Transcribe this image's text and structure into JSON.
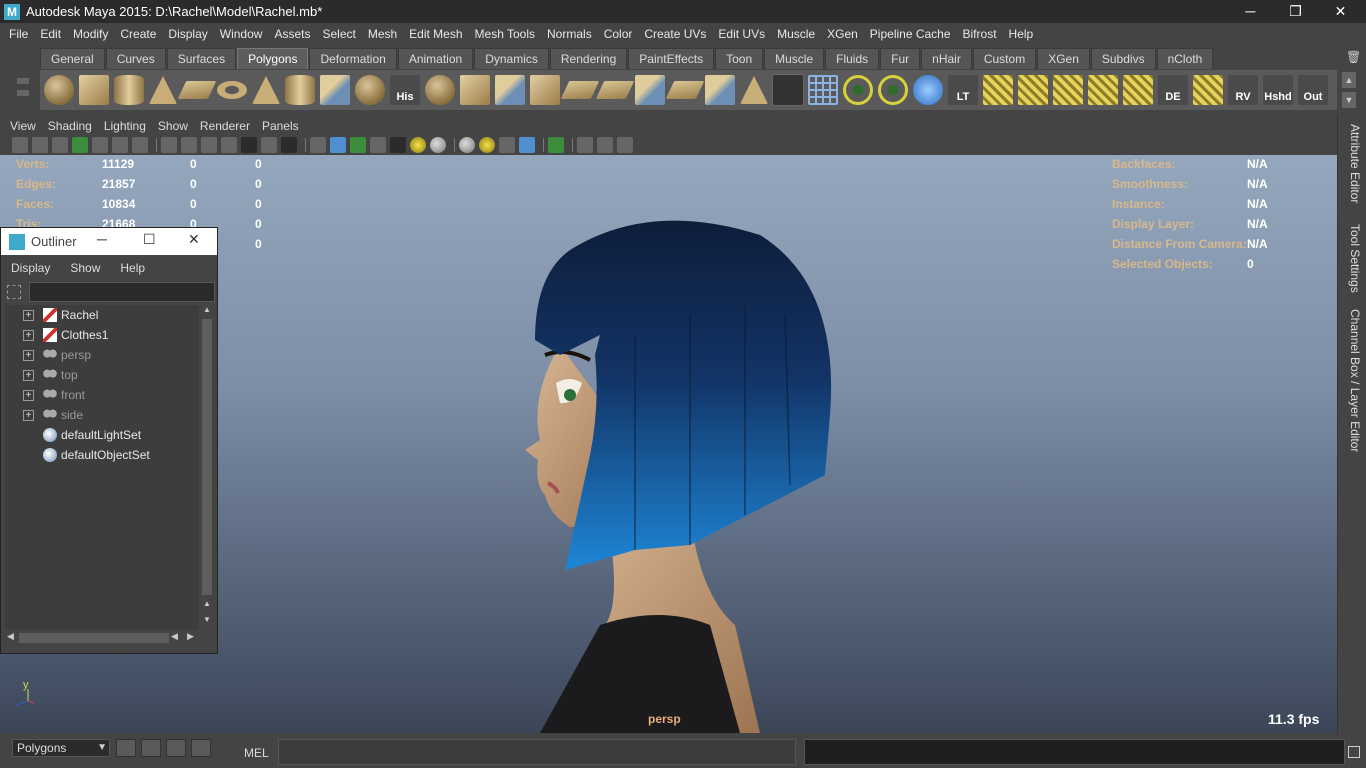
{
  "window": {
    "title": "Autodesk Maya 2015: D:\\Rachel\\Model\\Rachel.mb*",
    "minimize": "─",
    "restore": "❐",
    "close": "✕"
  },
  "menubar": [
    "File",
    "Edit",
    "Modify",
    "Create",
    "Display",
    "Window",
    "Assets",
    "Select",
    "Mesh",
    "Edit Mesh",
    "Mesh Tools",
    "Normals",
    "Color",
    "Create UVs",
    "Edit UVs",
    "Muscle",
    "XGen",
    "Pipeline Cache",
    "Bifrost",
    "Help"
  ],
  "shelf": {
    "tabs": [
      "General",
      "Curves",
      "Surfaces",
      "Polygons",
      "Deformation",
      "Animation",
      "Dynamics",
      "Rendering",
      "PaintEffects",
      "Toon",
      "Muscle",
      "Fluids",
      "Fur",
      "nHair",
      "Custom",
      "XGen",
      "Subdivs",
      "nCloth"
    ],
    "active_tab": "Polygons",
    "text_icons": {
      "his": "His",
      "lt": "LT",
      "de": "DE",
      "rv": "RV",
      "hshd": "Hshd",
      "out": "Out"
    }
  },
  "panel": {
    "menus": [
      "View",
      "Shading",
      "Lighting",
      "Show",
      "Renderer",
      "Panels"
    ]
  },
  "hud_left": [
    {
      "label": "Verts:",
      "v1": "11129",
      "v2": "0",
      "v3": "0"
    },
    {
      "label": "Edges:",
      "v1": "21857",
      "v2": "0",
      "v3": "0"
    },
    {
      "label": "Faces:",
      "v1": "10834",
      "v2": "0",
      "v3": "0"
    },
    {
      "label": "Tris:",
      "v1": "21668",
      "v2": "0",
      "v3": "0"
    },
    {
      "label": "",
      "v1": "",
      "v2": "0",
      "v3": "0"
    }
  ],
  "hud_right": [
    {
      "label": "Backfaces:",
      "value": "N/A"
    },
    {
      "label": "Smoothness:",
      "value": "N/A"
    },
    {
      "label": "Instance:",
      "value": "N/A"
    },
    {
      "label": "Display Layer:",
      "value": "N/A"
    },
    {
      "label": "Distance From Camera:",
      "value": "N/A"
    },
    {
      "label": "Selected Objects:",
      "value": "0"
    }
  ],
  "viewport": {
    "camera": "persp",
    "fps": "11.3 fps",
    "axis_y": "y"
  },
  "side_tabs": [
    "Attribute Editor",
    "Tool Settings",
    "Channel Box / Layer Editor"
  ],
  "outliner": {
    "title": "Outliner",
    "menus": [
      "Display",
      "Show",
      "Help"
    ],
    "search_value": "",
    "items": [
      {
        "label": "Rachel",
        "icon": "mesh-icon",
        "expandable": true,
        "dim": false
      },
      {
        "label": "Clothes1",
        "icon": "mesh-icon",
        "expandable": true,
        "dim": false
      },
      {
        "label": "persp",
        "icon": "camera-icon",
        "expandable": true,
        "dim": true
      },
      {
        "label": "top",
        "icon": "camera-icon",
        "expandable": true,
        "dim": true
      },
      {
        "label": "front",
        "icon": "camera-icon",
        "expandable": true,
        "dim": true
      },
      {
        "label": "side",
        "icon": "camera-icon",
        "expandable": true,
        "dim": true
      },
      {
        "label": "defaultLightSet",
        "icon": "set-icon",
        "expandable": false,
        "dim": false
      },
      {
        "label": "defaultObjectSet",
        "icon": "set-icon",
        "expandable": false,
        "dim": false
      }
    ]
  },
  "commandline": {
    "mode": "Polygons",
    "mel_label": "MEL",
    "input_value": "",
    "result": ""
  }
}
